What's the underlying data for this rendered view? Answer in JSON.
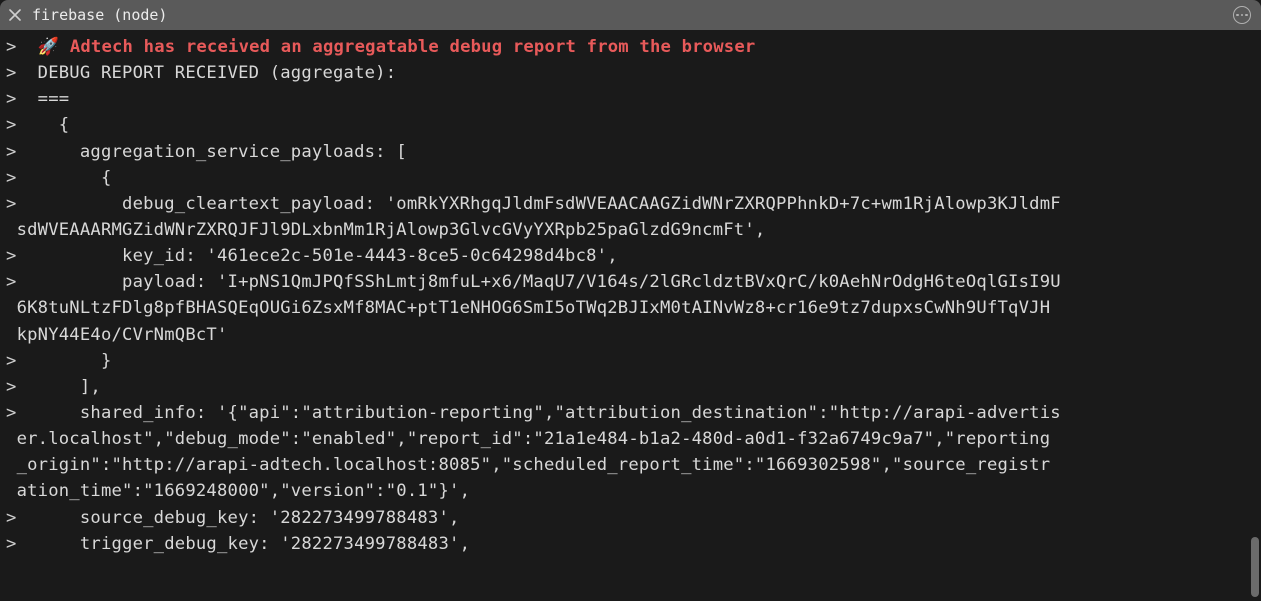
{
  "tab": {
    "title": "firebase (node)",
    "close_icon": "close-icon",
    "more_icon": "more-icon"
  },
  "prompt": ">  ",
  "headline": {
    "emoji": "🚀",
    "text": " Adtech has received an aggregatable debug report from the browser"
  },
  "lines": {
    "l2": "DEBUG REPORT RECEIVED (aggregate):",
    "l3": "===",
    "l4": "  {",
    "l5": "    aggregation_service_payloads: [",
    "l6": "      {",
    "l7a": "        debug_cleartext_payload: 'omRkYXRhgqJldmFsdWVEAACAAGZidWNrZXRQPPhnkD+7c+wm1RjAlowp3KJldmF",
    "l7b": " sdWVEAAARMGZidWNrZXRQJFJl9DLxbnMm1RjAlowp3GlvcGVyYXRpb25paGlzdG9ncmFt',",
    "l8": "        key_id: '461ece2c-501e-4443-8ce5-0c64298d4bc8',",
    "l9a": "        payload: 'I+pNS1QmJPQfSShLmtj8mfuL+x6/MaqU7/V164s/2lGRcldztBVxQrC/k0AehNrOdgH6teOqlGIsI9U",
    "l9b": " 6K8tuNLtzFDlg8pfBHASQEqOUGi6ZsxMf8MAC+ptT1eNHOG6SmI5oTWq2BJIxM0tAINvWz8+cr16e9tz7dupxsCwNh9UfTqVJH",
    "l9c": " kpNY44E4o/CVrNmQBcT'",
    "l10": "      }",
    "l11": "    ],",
    "l12a": "    shared_info: '{\"api\":\"attribution-reporting\",\"attribution_destination\":\"http://arapi-advertis",
    "l12b": " er.localhost\",\"debug_mode\":\"enabled\",\"report_id\":\"21a1e484-b1a2-480d-a0d1-f32a6749c9a7\",\"reporting",
    "l12c": " _origin\":\"http://arapi-adtech.localhost:8085\",\"scheduled_report_time\":\"1669302598\",\"source_registr",
    "l12d": " ation_time\":\"1669248000\",\"version\":\"0.1\"}',",
    "l13": "    source_debug_key: '282273499788483',",
    "l14": "    trigger_debug_key: '282273499788483',"
  }
}
